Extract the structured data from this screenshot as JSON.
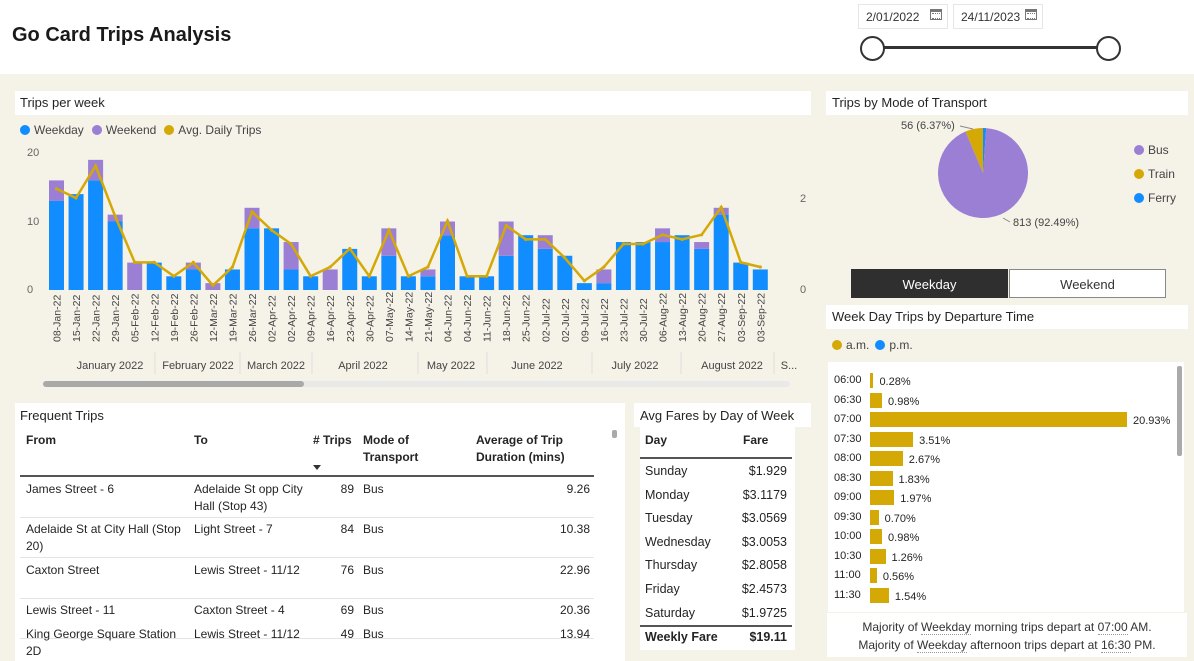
{
  "header": {
    "title": "Go Card Trips Analysis",
    "date_start": "2/01/2022",
    "date_end": "24/11/2023"
  },
  "trips_per_week": {
    "title": "Trips per week",
    "legend": [
      {
        "label": "Weekday",
        "color": "#118dff"
      },
      {
        "label": "Weekend",
        "color": "#9b7fd4"
      },
      {
        "label": "Avg. Daily Trips",
        "color": "#d4a906"
      }
    ],
    "y_ticks": [
      "20",
      "10",
      "0"
    ],
    "y2_ticks": [
      "2",
      "0"
    ],
    "months": [
      "January 2022",
      "February 2022",
      "March 2022",
      "April 2022",
      "May 2022",
      "June 2022",
      "July 2022",
      "August 2022",
      "S..."
    ]
  },
  "chart_data": [
    {
      "type": "bar",
      "title": "Trips per week",
      "categories": [
        "08-Jan-22",
        "15-Jan-22",
        "22-Jan-22",
        "29-Jan-22",
        "05-Feb-22",
        "12-Feb-22",
        "19-Feb-22",
        "26-Feb-22",
        "12-Mar-22",
        "19-Mar-22",
        "26-Mar-22",
        "02-Apr-22",
        "02-Apr-22",
        "09-Apr-22",
        "16-Apr-22",
        "23-Apr-22",
        "30-Apr-22",
        "07-May-22",
        "14-May-22",
        "21-May-22",
        "04-Jun-22",
        "04-Jun-22",
        "11-Jun-22",
        "18-Jun-22",
        "25-Jun-22",
        "02-Jul-22",
        "02-Jul-22",
        "09-Jul-22",
        "16-Jul-22",
        "23-Jul-22",
        "30-Jul-22",
        "06-Aug-22",
        "13-Aug-22",
        "20-Aug-22",
        "27-Aug-22",
        "03-Sep-22",
        "03-Sep-22"
      ],
      "series": [
        {
          "name": "Weekday",
          "values": [
            13,
            14,
            16,
            10,
            0,
            4,
            2,
            3,
            0,
            3,
            9,
            9,
            3,
            2,
            0,
            6,
            2,
            5,
            2,
            2,
            8,
            2,
            2,
            5,
            8,
            6,
            5,
            1,
            1,
            7,
            7,
            7,
            8,
            6,
            11,
            4,
            3
          ]
        },
        {
          "name": "Weekend",
          "values": [
            3,
            0,
            3,
            1,
            4,
            0,
            0,
            1,
            1,
            0,
            3,
            0,
            4,
            0,
            3,
            0,
            0,
            4,
            0,
            1,
            2,
            0,
            0,
            5,
            0,
            2,
            0,
            0,
            2,
            0,
            0,
            2,
            0,
            1,
            1,
            0,
            0
          ]
        },
        {
          "name": "Avg. Daily Trips",
          "values": [
            2.2,
            2.0,
            2.7,
            1.6,
            0.6,
            0.6,
            0.3,
            0.6,
            0.1,
            0.5,
            1.7,
            1.3,
            1.0,
            0.3,
            0.5,
            0.9,
            0.3,
            1.3,
            0.3,
            0.5,
            1.5,
            0.3,
            0.3,
            1.4,
            1.1,
            1.1,
            0.7,
            0.2,
            0.5,
            1.0,
            1.0,
            1.2,
            1.1,
            1.2,
            1.8,
            0.6,
            0.5
          ]
        }
      ],
      "ylim": [
        0,
        20
      ],
      "y2lim": [
        0,
        2
      ]
    },
    {
      "type": "pie",
      "title": "Trips by Mode of Transport",
      "categories": [
        "Bus",
        "Train",
        "Ferry"
      ],
      "values": [
        813,
        56,
        10
      ],
      "labels": [
        "813 (92.49%)",
        "56 (6.37%)"
      ],
      "colors": [
        "#9b7fd4",
        "#d4a906",
        "#118dff"
      ]
    },
    {
      "type": "bar",
      "title": "Week Day Trips by Departure Time",
      "categories": [
        "06:00",
        "06:30",
        "07:00",
        "07:30",
        "08:00",
        "08:30",
        "09:00",
        "09:30",
        "10:00",
        "10:30",
        "11:00",
        "11:30"
      ],
      "values": [
        0.28,
        0.98,
        20.93,
        3.51,
        2.67,
        1.83,
        1.97,
        0.7,
        0.98,
        1.26,
        0.56,
        1.54
      ],
      "labels": [
        "0.28%",
        "0.98%",
        "20.93%",
        "3.51%",
        "2.67%",
        "1.83%",
        "1.97%",
        "0.70%",
        "0.98%",
        "1.26%",
        "0.56%",
        "1.54%"
      ]
    }
  ],
  "mode_of_transport": {
    "title": "Trips by Mode of Transport",
    "legend": [
      "Bus",
      "Train",
      "Ferry"
    ],
    "label_bus": "813 (92.49%)",
    "label_train": "56 (6.37%)"
  },
  "toggle": {
    "weekday": "Weekday",
    "weekend": "Weekend"
  },
  "departure": {
    "title": "Week Day Trips by Departure Time",
    "legend_am": "a.m.",
    "legend_pm": "p.m."
  },
  "frequent_trips": {
    "title": "Frequent Trips",
    "columns": [
      "From",
      "To",
      "# Trips",
      "Mode of Transport",
      "Average of Trip Duration (mins)"
    ],
    "rows": [
      {
        "from": "James Street - 6",
        "to": "Adelaide St opp City Hall (Stop 43)",
        "trips": "89",
        "mode": "Bus",
        "duration": "9.26"
      },
      {
        "from": "Adelaide St at City Hall (Stop 20)",
        "to": "Light Street - 7",
        "trips": "84",
        "mode": "Bus",
        "duration": "10.38"
      },
      {
        "from": "Caxton Street",
        "to": "Lewis Street - 11/12",
        "trips": "76",
        "mode": "Bus",
        "duration": "22.96"
      },
      {
        "from": "Lewis Street - 11",
        "to": "Caxton Street - 4",
        "trips": "69",
        "mode": "Bus",
        "duration": "20.36"
      },
      {
        "from": "King George Square Station 2D",
        "to": "Lewis Street - 11/12",
        "trips": "49",
        "mode": "Bus",
        "duration": "13.94"
      }
    ]
  },
  "fares": {
    "title": "Avg Fares by Day of Week",
    "col_day": "Day",
    "col_fare": "Fare",
    "rows": [
      {
        "day": "Sunday",
        "fare": "$1.929"
      },
      {
        "day": "Monday",
        "fare": "$3.1179"
      },
      {
        "day": "Tuesday",
        "fare": "$3.0569"
      },
      {
        "day": "Wednesday",
        "fare": "$3.0053"
      },
      {
        "day": "Thursday",
        "fare": "$2.8058"
      },
      {
        "day": "Friday",
        "fare": "$2.4573"
      },
      {
        "day": "Saturday",
        "fare": "$1.9725"
      }
    ],
    "total_label": "Weekly Fare",
    "total_value": "$19.11"
  },
  "footnote": {
    "l1_a": "Majority of ",
    "l1_b": "Weekday",
    "l1_c": " morning trips depart at ",
    "l1_d": "07:00",
    "l1_e": " AM.",
    "l2_a": "Majority of ",
    "l2_b": "Weekday",
    "l2_c": " afternoon trips depart at ",
    "l2_d": "16:30",
    "l2_e": " PM."
  }
}
